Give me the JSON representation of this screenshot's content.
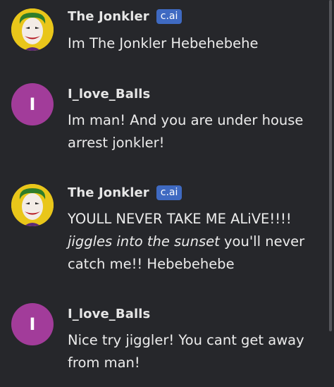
{
  "messages": [
    {
      "author": "The Jonkler",
      "badge": "c.ai",
      "text": "Im The Jonkler Hebehebehe"
    },
    {
      "author": "I_love_Balls",
      "avatar_letter": "I",
      "text": "Im man! And you are under house arrest jonkler!"
    },
    {
      "author": "The Jonkler",
      "badge": "c.ai",
      "text_part1": "YOULL NEVER TAKE ME ALiVE!!!!",
      "text_italic": "jiggles into the sunset",
      "text_part2": " you'll never catch me!! Hebebehebe"
    },
    {
      "author": "I_love_Balls",
      "avatar_letter": "I",
      "text": "Nice try jiggler! You cant get away from man!"
    }
  ],
  "colors": {
    "background": "#26272b",
    "user_avatar": "#a23c9a",
    "badge": "#3f6ac2"
  },
  "icons": {
    "bot_avatar": "joker-face-avatar"
  }
}
